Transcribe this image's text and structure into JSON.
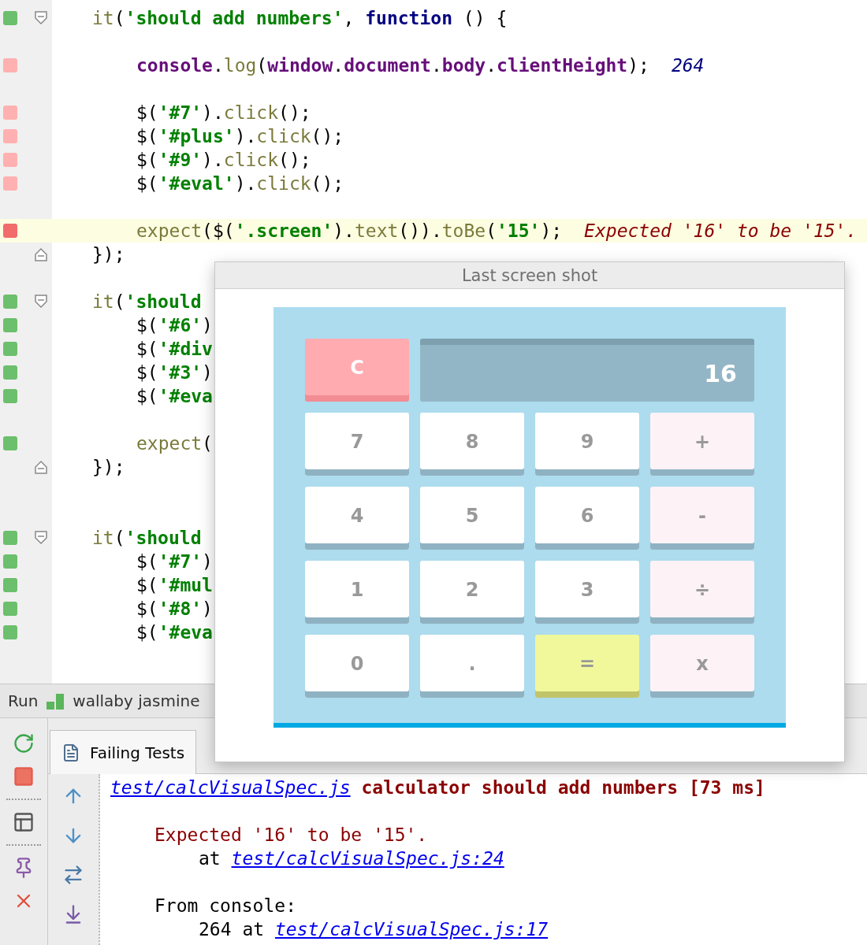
{
  "editor": {
    "lines": [
      {
        "kind": "opener",
        "color": "#6cbf6c",
        "highlighted": false,
        "tokens": [
          {
            "text": "it",
            "kind": "call"
          },
          {
            "text": "(",
            "kind": "plain"
          },
          {
            "text": "'should add numbers'",
            "kind": "string"
          },
          {
            "text": ", ",
            "kind": "plain"
          },
          {
            "text": "function",
            "kind": "keyword"
          },
          {
            "text": " () {",
            "kind": "plain"
          }
        ],
        "children": [
          {
            "kind": "blank"
          },
          {
            "kind": "code",
            "color": "#ffb0b0",
            "highlighted": false,
            "tokens": [
              {
                "text": "console",
                "kind": "global"
              },
              {
                "text": ".",
                "kind": "plain"
              },
              {
                "text": "log",
                "kind": "call"
              },
              {
                "text": "(",
                "kind": "plain"
              },
              {
                "text": "window",
                "kind": "global"
              },
              {
                "text": ".",
                "kind": "plain"
              },
              {
                "text": "document",
                "kind": "global"
              },
              {
                "text": ".",
                "kind": "plain"
              },
              {
                "text": "body",
                "kind": "global"
              },
              {
                "text": ".",
                "kind": "plain"
              },
              {
                "text": "clientHeight",
                "kind": "global"
              },
              {
                "text": ");",
                "kind": "plain"
              }
            ],
            "annotation": {
              "text": "264",
              "kind": "value"
            }
          },
          {
            "kind": "blank"
          },
          {
            "kind": "code",
            "color": "#ffb0b0",
            "highlighted": false,
            "tokens": [
              {
                "text": "$(",
                "kind": "plain"
              },
              {
                "text": "'#7'",
                "kind": "string"
              },
              {
                "text": ").",
                "kind": "plain"
              },
              {
                "text": "click",
                "kind": "call"
              },
              {
                "text": "();",
                "kind": "plain"
              }
            ]
          },
          {
            "kind": "code",
            "color": "#ffb0b0",
            "highlighted": false,
            "tokens": [
              {
                "text": "$(",
                "kind": "plain"
              },
              {
                "text": "'#plus'",
                "kind": "string"
              },
              {
                "text": ").",
                "kind": "plain"
              },
              {
                "text": "click",
                "kind": "call"
              },
              {
                "text": "();",
                "kind": "plain"
              }
            ]
          },
          {
            "kind": "code",
            "color": "#ffb0b0",
            "highlighted": false,
            "tokens": [
              {
                "text": "$(",
                "kind": "plain"
              },
              {
                "text": "'#9'",
                "kind": "string"
              },
              {
                "text": ").",
                "kind": "plain"
              },
              {
                "text": "click",
                "kind": "call"
              },
              {
                "text": "();",
                "kind": "plain"
              }
            ]
          },
          {
            "kind": "code",
            "color": "#ffb0b0",
            "highlighted": false,
            "tokens": [
              {
                "text": "$(",
                "kind": "plain"
              },
              {
                "text": "'#eval'",
                "kind": "string"
              },
              {
                "text": ").",
                "kind": "plain"
              },
              {
                "text": "click",
                "kind": "call"
              },
              {
                "text": "();",
                "kind": "plain"
              }
            ]
          },
          {
            "kind": "blank"
          },
          {
            "kind": "code",
            "color": "#f26c6c",
            "highlighted": true,
            "tokens": [
              {
                "text": "expect",
                "kind": "call"
              },
              {
                "text": "($(",
                "kind": "plain"
              },
              {
                "text": "'.screen'",
                "kind": "string"
              },
              {
                "text": ").",
                "kind": "plain"
              },
              {
                "text": "text",
                "kind": "call"
              },
              {
                "text": "()).",
                "kind": "plain"
              },
              {
                "text": "toBe",
                "kind": "call"
              },
              {
                "text": "(",
                "kind": "plain"
              },
              {
                "text": "'15'",
                "kind": "string"
              },
              {
                "text": ");",
                "kind": "plain"
              }
            ],
            "annotation": {
              "text": "Expected '16' to be '15'.",
              "kind": "error"
            }
          }
        ]
      },
      {
        "kind": "closer",
        "highlighted": false,
        "tokens": [
          {
            "text": "});",
            "kind": "plain"
          }
        ]
      },
      {
        "kind": "blank"
      },
      {
        "kind": "opener",
        "color": "#6cbf6c",
        "highlighted": false,
        "tokens": [
          {
            "text": "it",
            "kind": "call"
          },
          {
            "text": "(",
            "kind": "plain"
          },
          {
            "text": "'should",
            "kind": "string"
          }
        ],
        "children": [
          {
            "kind": "code",
            "color": "#6cbf6c",
            "highlighted": false,
            "tokens": [
              {
                "text": "$(",
                "kind": "plain"
              },
              {
                "text": "'#6'",
                "kind": "string"
              },
              {
                "text": ")",
                "kind": "plain"
              }
            ]
          },
          {
            "kind": "code",
            "color": "#6cbf6c",
            "highlighted": false,
            "tokens": [
              {
                "text": "$(",
                "kind": "plain"
              },
              {
                "text": "'#div",
                "kind": "string"
              }
            ]
          },
          {
            "kind": "code",
            "color": "#6cbf6c",
            "highlighted": false,
            "tokens": [
              {
                "text": "$(",
                "kind": "plain"
              },
              {
                "text": "'#3'",
                "kind": "string"
              },
              {
                "text": ")",
                "kind": "plain"
              }
            ]
          },
          {
            "kind": "code",
            "color": "#6cbf6c",
            "highlighted": false,
            "tokens": [
              {
                "text": "$(",
                "kind": "plain"
              },
              {
                "text": "'#eva",
                "kind": "string"
              }
            ]
          },
          {
            "kind": "blank"
          },
          {
            "kind": "code",
            "color": "#6cbf6c",
            "highlighted": false,
            "tokens": [
              {
                "text": "expect",
                "kind": "call"
              },
              {
                "text": "(",
                "kind": "plain"
              }
            ]
          }
        ]
      },
      {
        "kind": "closer",
        "highlighted": false,
        "tokens": [
          {
            "text": "});",
            "kind": "plain"
          }
        ]
      },
      {
        "kind": "blank"
      },
      {
        "kind": "blank"
      },
      {
        "kind": "opener",
        "color": "#6cbf6c",
        "highlighted": false,
        "tokens": [
          {
            "text": "it",
            "kind": "call"
          },
          {
            "text": "(",
            "kind": "plain"
          },
          {
            "text": "'should",
            "kind": "string"
          }
        ],
        "children": [
          {
            "kind": "code",
            "color": "#6cbf6c",
            "highlighted": false,
            "tokens": [
              {
                "text": "$(",
                "kind": "plain"
              },
              {
                "text": "'#7'",
                "kind": "string"
              },
              {
                "text": ")",
                "kind": "plain"
              }
            ]
          },
          {
            "kind": "code",
            "color": "#6cbf6c",
            "highlighted": false,
            "tokens": [
              {
                "text": "$(",
                "kind": "plain"
              },
              {
                "text": "'#mul",
                "kind": "string"
              }
            ]
          },
          {
            "kind": "code",
            "color": "#6cbf6c",
            "highlighted": false,
            "tokens": [
              {
                "text": "$(",
                "kind": "plain"
              },
              {
                "text": "'#8'",
                "kind": "string"
              },
              {
                "text": ")",
                "kind": "plain"
              }
            ]
          },
          {
            "kind": "code",
            "color": "#6cbf6c",
            "highlighted": false,
            "tokens": [
              {
                "text": "$(",
                "kind": "plain"
              },
              {
                "text": "'#eva",
                "kind": "string"
              }
            ]
          }
        ]
      }
    ]
  },
  "run_bar": {
    "label": "Run",
    "config": "wallaby jasmine"
  },
  "panel": {
    "tabs": [
      {
        "label": "Failing Tests",
        "selected": true
      }
    ],
    "output": [
      {
        "segments": [
          {
            "text": "test/calcVisualSpec.js",
            "kind": "link"
          },
          {
            "text": " calculator should add numbers [73 ms]",
            "kind": "title"
          }
        ]
      },
      {
        "kind": "blank"
      },
      {
        "segments": [
          {
            "text": "Expected '16' to be '15'.",
            "kind": "error"
          }
        ],
        "children": [
          {
            "segments": [
              {
                "text": "at ",
                "kind": "plain"
              },
              {
                "text": "test/calcVisualSpec.js:24",
                "kind": "link"
              }
            ]
          }
        ]
      },
      {
        "kind": "blank"
      },
      {
        "segments": [
          {
            "text": "From console:",
            "kind": "plain"
          }
        ],
        "children": [
          {
            "segments": [
              {
                "text": "264 at ",
                "kind": "plain"
              },
              {
                "text": "test/calcVisualSpec.js:17",
                "kind": "link"
              }
            ]
          }
        ]
      }
    ]
  },
  "popup": {
    "title": "Last screen shot",
    "calculator": {
      "display": "16",
      "keys": [
        {
          "label": "C",
          "kind": "clear"
        },
        {
          "label": "7",
          "kind": "digit"
        },
        {
          "label": "8",
          "kind": "digit"
        },
        {
          "label": "9",
          "kind": "digit"
        },
        {
          "label": "+",
          "kind": "operator"
        },
        {
          "label": "4",
          "kind": "digit"
        },
        {
          "label": "5",
          "kind": "digit"
        },
        {
          "label": "6",
          "kind": "digit"
        },
        {
          "label": "-",
          "kind": "operator"
        },
        {
          "label": "1",
          "kind": "digit"
        },
        {
          "label": "2",
          "kind": "digit"
        },
        {
          "label": "3",
          "kind": "digit"
        },
        {
          "label": "÷",
          "kind": "operator"
        },
        {
          "label": "0",
          "kind": "digit"
        },
        {
          "label": ".",
          "kind": "digit"
        },
        {
          "label": "=",
          "kind": "equals"
        },
        {
          "label": "x",
          "kind": "operator"
        }
      ]
    }
  }
}
